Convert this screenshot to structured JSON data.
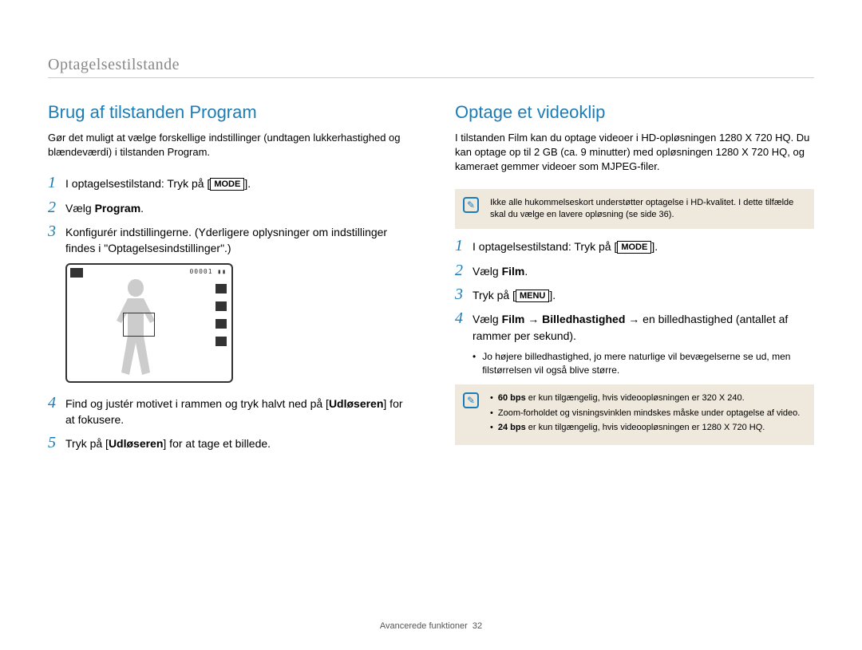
{
  "header": {
    "section": "Optagelsestilstande"
  },
  "left": {
    "title": "Brug af tilstanden Program",
    "intro": "Gør det muligt at vælge forskellige indstillinger (undtagen lukkerhastighed og blændeværdi) i tilstanden Program.",
    "steps": {
      "s1a": "I optagelsestilstand: Tryk på [",
      "s1btn": "MODE",
      "s1b": "].",
      "s2a": "Vælg ",
      "s2bold": "Program",
      "s2b": ".",
      "s3": "Konfigurér indstillingerne. (Yderligere oplysninger om indstillinger findes i \"Optagelsesindstillinger\".)",
      "s4a": "Find og justér motivet i rammen og tryk halvt ned på [",
      "s4bold": "Udløseren",
      "s4b": "] for at fokusere.",
      "s5a": "Tryk på [",
      "s5bold": "Udløseren",
      "s5b": "] for at tage et billede."
    },
    "screen_counter": "00001"
  },
  "right": {
    "title": "Optage et videoklip",
    "intro": "I tilstanden Film kan du optage videoer i HD-opløsningen 1280 X 720 HQ. Du kan optage op til 2 GB (ca. 9 minutter) med opløsningen 1280 X 720 HQ, og kameraet gemmer videoer som MJPEG-filer.",
    "note1": "Ikke alle hukommelseskort understøtter optagelse i HD-kvalitet. I dette tilfælde skal du vælge en lavere opløsning (se side 36).",
    "steps": {
      "s1a": "I optagelsestilstand: Tryk på [",
      "s1btn": "MODE",
      "s1b": "].",
      "s2a": "Vælg ",
      "s2bold": "Film",
      "s2b": ".",
      "s3a": "Tryk på [",
      "s3btn": "MENU",
      "s3b": "].",
      "s4a": "Vælg ",
      "s4b1": "Film",
      "s4arrow1": " → ",
      "s4b2": "Billedhastighed",
      "s4arrow2": " → en billedhastighed (antallet af rammer per sekund).",
      "sub": "Jo højere billedhastighed, jo mere naturlige vil bevægelserne se ud, men filstørrelsen vil også blive større."
    },
    "note2": {
      "i1a": "60 bps",
      "i1b": " er kun tilgængelig, hvis videoopløsningen er 320 X 240.",
      "i2": "Zoom-forholdet og visningsvinklen mindskes måske under optagelse af video.",
      "i3a": "24 bps",
      "i3b": " er kun tilgængelig, hvis videoopløsningen er 1280 X 720 HQ."
    }
  },
  "footer": {
    "label": "Avancerede funktioner",
    "page": "32"
  },
  "nums": {
    "n1": "1",
    "n2": "2",
    "n3": "3",
    "n4": "4",
    "n5": "5"
  }
}
